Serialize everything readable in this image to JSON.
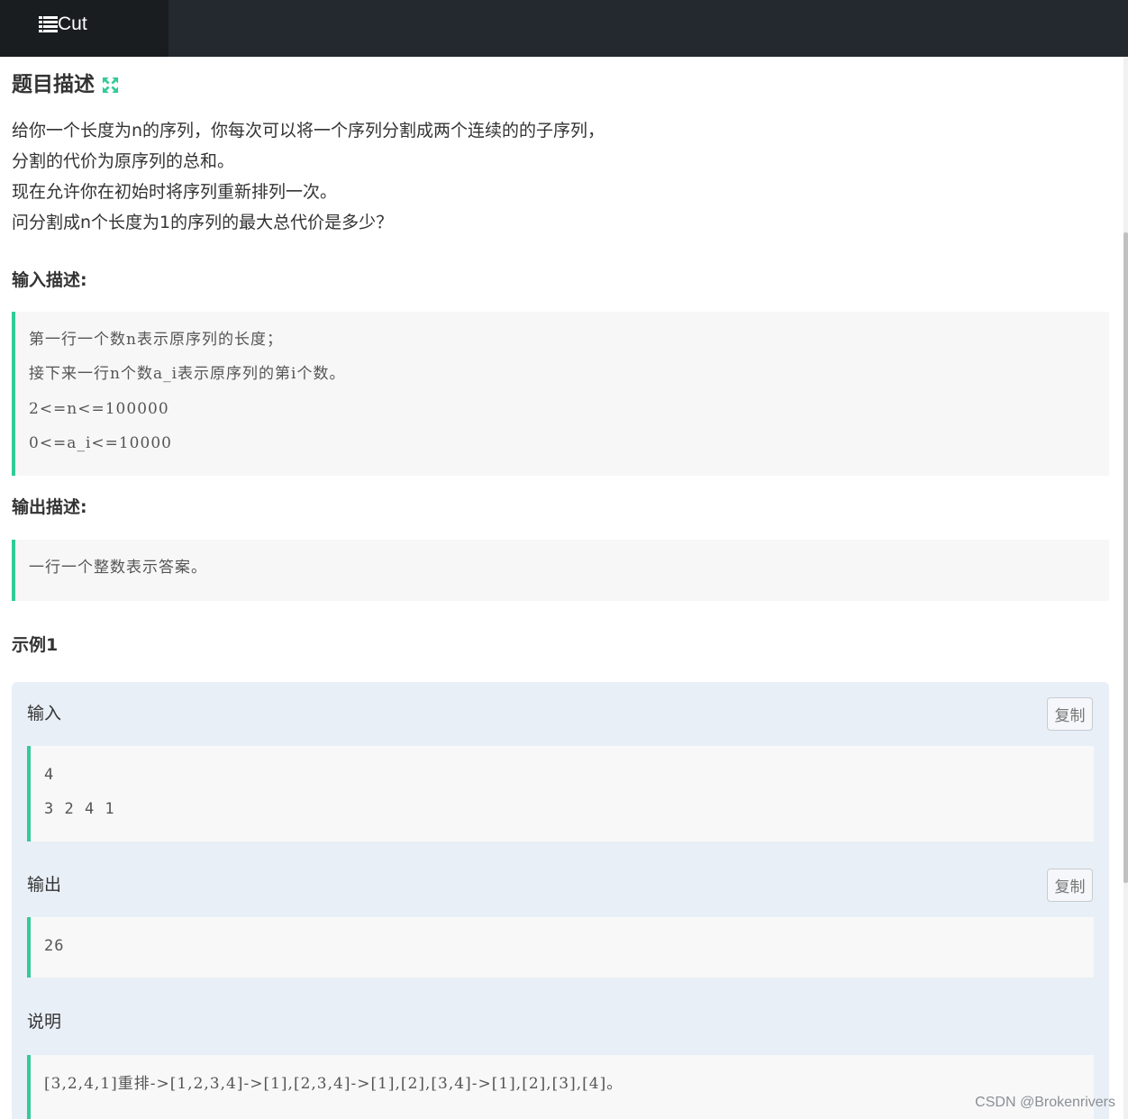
{
  "topbar": {
    "tab_label": "Cut",
    "tab_icon": "list-icon"
  },
  "title": {
    "text": "题目描述",
    "icon": "expand-icon",
    "icon_color": "#32ca99"
  },
  "description": {
    "lines": [
      "给你一个长度为n的序列，你每次可以将一个序列分割成两个连续的的子序列，",
      "分割的代价为原序列的总和。",
      "现在允许你在初始时将序列重新排列一次。",
      "问分割成n个长度为1的序列的最大总代价是多少？"
    ]
  },
  "input_section": {
    "heading": "输入描述:",
    "lines": [
      "第一行一个数n表示原序列的长度；",
      "接下来一行n个数a_i表示原序列的第i个数。",
      "2<=n<=100000",
      "0<=a_i<=10000"
    ]
  },
  "output_section": {
    "heading": "输出描述:",
    "lines": [
      "一行一个整数表示答案。"
    ]
  },
  "example": {
    "heading": "示例1",
    "input_label": "输入",
    "input_lines": [
      "4",
      "3 2 4 1"
    ],
    "output_label": "输出",
    "output_lines": [
      "26"
    ],
    "explain_label": "说明",
    "explain_lines": [
      "[3,2,4,1]重排->[1,2,3,4]->[1],[2,3,4]->[1],[2],[3,4]->[1],[2],[3],[4]。"
    ],
    "copy_label": "复制"
  },
  "watermark": "CSDN @Brokenrivers",
  "colors": {
    "accent": "#32ca99",
    "topbar": "#23292f",
    "example_bg": "#e9eff6"
  }
}
